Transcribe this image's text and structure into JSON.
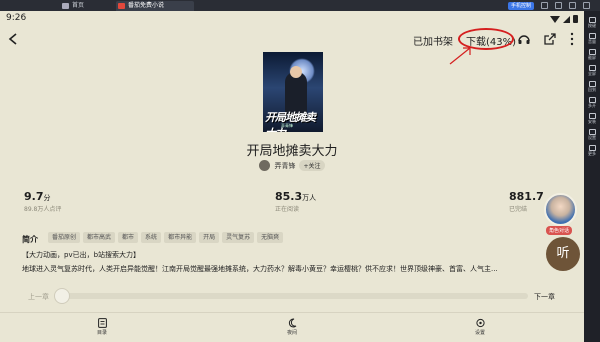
{
  "emulator": {
    "tabs": [
      {
        "label": "首页",
        "icon": "home-icon"
      },
      {
        "label": "番茄免费小说",
        "icon": "app-icon"
      }
    ],
    "badge": "手机控制",
    "toolbar": [
      "按键",
      "音量",
      "截屏",
      "全屏",
      "回到",
      "多开",
      "安装",
      "设置",
      "更多"
    ]
  },
  "status_bar": {
    "time": "9:26"
  },
  "nav": {
    "back_icon": "back-arrow-icon",
    "shelf_label": "已加书架",
    "download_label": "下载(43%)",
    "download_progress": 0.43,
    "annotation_color": "#d51f1f"
  },
  "book": {
    "cover_title": "开局地摊卖大力",
    "title": "开局地摊卖大力",
    "author": "弄青锋",
    "follow_label": "+关注"
  },
  "stats": [
    {
      "value": "9.7",
      "unit": "分",
      "caption": "89.8万人点评"
    },
    {
      "value": "85.3",
      "unit": "万人",
      "caption": "正在阅读"
    },
    {
      "value": "881.7",
      "unit": "",
      "caption": "已完结"
    }
  ],
  "character_chat": {
    "label": "角色对话"
  },
  "intro": {
    "heading": "简介",
    "tags": [
      "番茄原创",
      "都市高武",
      "都市",
      "系统",
      "都市异能",
      "开局",
      "灵气复苏",
      "无脑爽"
    ],
    "line1": "【大力动画，pv已出，b站搜索大力】",
    "line2": "地球进入灵气复苏时代，人类开启异能觉醒！江南开局觉醒最强地摊系统，大力药水？解毒小黄豆？幸运樱桃？供不应求！世界顶级神豪、首富、人气主..."
  },
  "listen_label": "听",
  "chapter_nav": {
    "prev": "上一章",
    "next": "下一章",
    "progress": 0
  },
  "bottom_bar": [
    {
      "label": "目录",
      "icon": "catalog-icon"
    },
    {
      "label": "夜间",
      "icon": "moon-icon"
    },
    {
      "label": "设置",
      "icon": "settings-icon"
    }
  ]
}
